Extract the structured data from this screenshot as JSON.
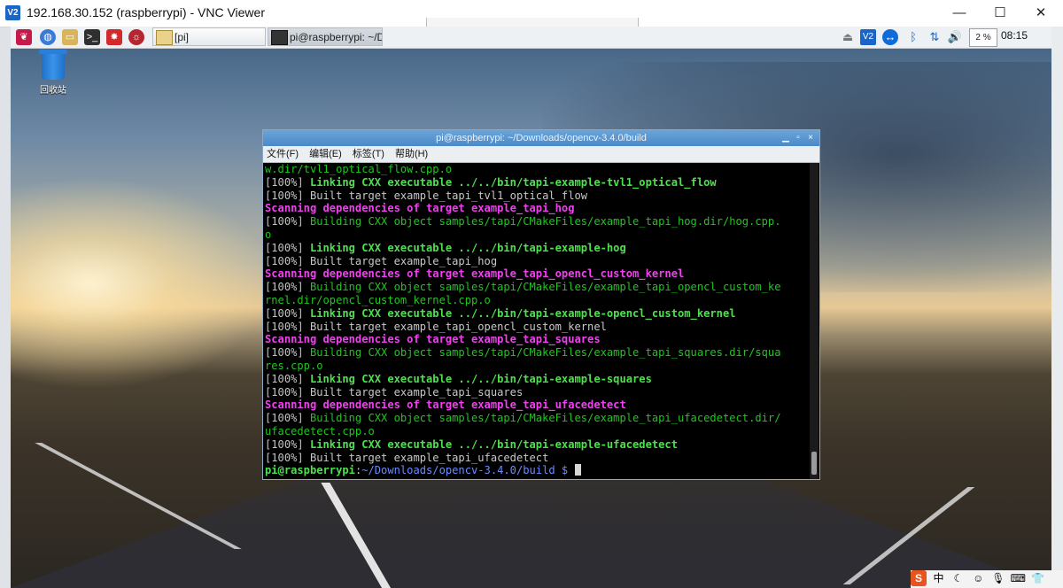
{
  "vnc": {
    "logo": "V2",
    "title": "192.168.30.152 (raspberrypi) - VNC Viewer",
    "minimize": "—",
    "maximize": "☐",
    "close": "✕"
  },
  "panel": {
    "tasks": [
      {
        "label": "[pi]"
      },
      {
        "label": "pi@raspberrypi: ~/Do..."
      }
    ],
    "cpu": "2 %",
    "clock": "08:15"
  },
  "desktop": {
    "trash_label": "回收站"
  },
  "terminal": {
    "title": "pi@raspberrypi: ~/Downloads/opencv-3.4.0/build",
    "menus": [
      "文件(F)",
      "编辑(E)",
      "标签(T)",
      "帮助(H)"
    ],
    "lines": [
      {
        "style": "green",
        "text": "w.dir/tvl1_optical_flow.cpp.o"
      },
      {
        "style": "dim",
        "prefix": "[100%] ",
        "style2": "greenb",
        "text": "Linking CXX executable ../../bin/tapi-example-tvl1_optical_flow"
      },
      {
        "style": "dim",
        "prefix": "[100%] ",
        "style2": "white",
        "text": "Built target example_tapi_tvl1_optical_flow"
      },
      {
        "style": "mag",
        "text": "Scanning dependencies of target example_tapi_hog"
      },
      {
        "style": "dim",
        "prefix": "[100%] ",
        "style2": "green",
        "text": "Building CXX object samples/tapi/CMakeFiles/example_tapi_hog.dir/hog.cpp."
      },
      {
        "style": "green",
        "text": "o"
      },
      {
        "style": "dim",
        "prefix": "[100%] ",
        "style2": "greenb",
        "text": "Linking CXX executable ../../bin/tapi-example-hog"
      },
      {
        "style": "dim",
        "prefix": "[100%] ",
        "style2": "white",
        "text": "Built target example_tapi_hog"
      },
      {
        "style": "mag",
        "text": "Scanning dependencies of target example_tapi_opencl_custom_kernel"
      },
      {
        "style": "dim",
        "prefix": "[100%] ",
        "style2": "green",
        "text": "Building CXX object samples/tapi/CMakeFiles/example_tapi_opencl_custom_ke"
      },
      {
        "style": "green",
        "text": "rnel.dir/opencl_custom_kernel.cpp.o"
      },
      {
        "style": "dim",
        "prefix": "[100%] ",
        "style2": "greenb",
        "text": "Linking CXX executable ../../bin/tapi-example-opencl_custom_kernel"
      },
      {
        "style": "dim",
        "prefix": "[100%] ",
        "style2": "white",
        "text": "Built target example_tapi_opencl_custom_kernel"
      },
      {
        "style": "mag",
        "text": "Scanning dependencies of target example_tapi_squares"
      },
      {
        "style": "dim",
        "prefix": "[100%] ",
        "style2": "green",
        "text": "Building CXX object samples/tapi/CMakeFiles/example_tapi_squares.dir/squa"
      },
      {
        "style": "green",
        "text": "res.cpp.o"
      },
      {
        "style": "dim",
        "prefix": "[100%] ",
        "style2": "greenb",
        "text": "Linking CXX executable ../../bin/tapi-example-squares"
      },
      {
        "style": "dim",
        "prefix": "[100%] ",
        "style2": "white",
        "text": "Built target example_tapi_squares"
      },
      {
        "style": "mag",
        "text": "Scanning dependencies of target example_tapi_ufacedetect"
      },
      {
        "style": "dim",
        "prefix": "[100%] ",
        "style2": "green",
        "text": "Building CXX object samples/tapi/CMakeFiles/example_tapi_ufacedetect.dir/"
      },
      {
        "style": "green",
        "text": "ufacedetect.cpp.o"
      },
      {
        "style": "dim",
        "prefix": "[100%] ",
        "style2": "greenb",
        "text": "Linking CXX executable ../../bin/tapi-example-ufacedetect"
      },
      {
        "style": "dim",
        "prefix": "[100%] ",
        "style2": "white",
        "text": "Built target example_tapi_ufacedetect"
      }
    ],
    "prompt": {
      "user": "pi@raspberrypi",
      "sep": ":",
      "path": "~/Downloads/opencv-3.4.0/build $ "
    }
  },
  "host_tray": {
    "ime_brand": "S",
    "ime_lang": "中",
    "icons": [
      "moon-punct",
      "emoji",
      "mic",
      "keyboard",
      "skin"
    ]
  }
}
